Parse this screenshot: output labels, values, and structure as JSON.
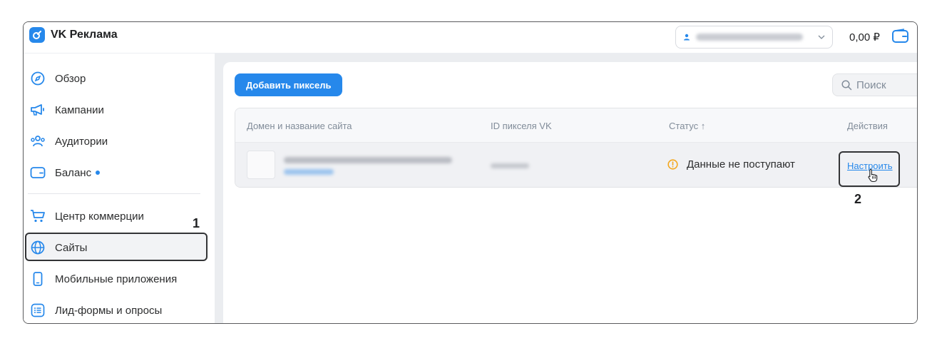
{
  "app": {
    "title": "VK Реклама"
  },
  "header": {
    "balance": "0,00 ₽",
    "wallet_icon": "wallet-icon"
  },
  "sidebar": {
    "items": [
      {
        "label": "Обзор",
        "icon": "compass-icon"
      },
      {
        "label": "Кампании",
        "icon": "megaphone-icon"
      },
      {
        "label": "Аудитории",
        "icon": "users-icon"
      },
      {
        "label": "Баланс",
        "icon": "wallet-icon",
        "badge": "dot"
      },
      {
        "label": "Центр коммерции",
        "icon": "cart-icon"
      },
      {
        "label": "Сайты",
        "icon": "globe-icon",
        "selected": true
      },
      {
        "label": "Мобильные приложения",
        "icon": "smartphone-icon"
      },
      {
        "label": "Лид-формы и опросы",
        "icon": "list-icon"
      }
    ]
  },
  "toolbar": {
    "add_label": "Добавить пиксель",
    "search_placeholder": "Поиск"
  },
  "table": {
    "columns": [
      "Домен и название сайта",
      "ID пикселя VK",
      "Статус ↑",
      "Действия"
    ],
    "rows": [
      {
        "status": "Данные не поступают",
        "action": "Настроить"
      }
    ]
  },
  "annotations": {
    "marker1": "1",
    "marker2": "2"
  },
  "colors": {
    "accent": "#2688eb",
    "warning": "#f4a71d",
    "highlight": "#333436"
  }
}
